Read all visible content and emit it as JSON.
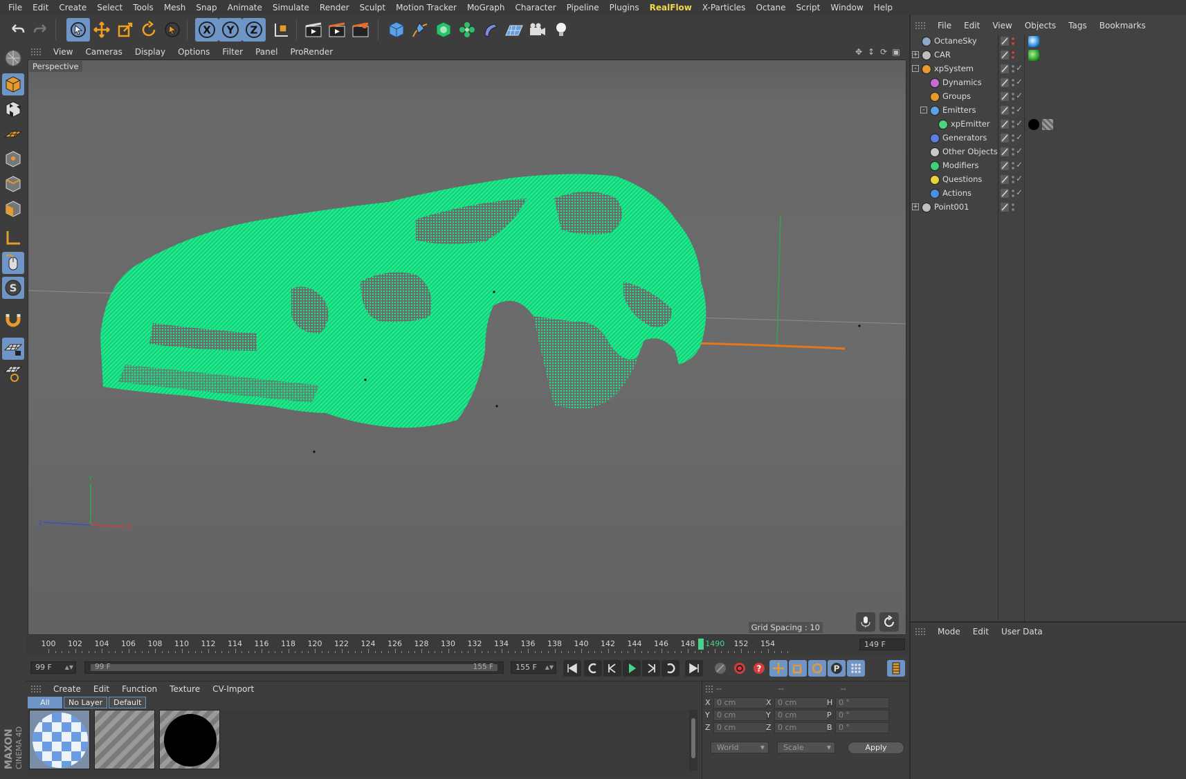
{
  "menubar": [
    "File",
    "Edit",
    "Create",
    "Select",
    "Tools",
    "Mesh",
    "Snap",
    "Animate",
    "Simulate",
    "Render",
    "Sculpt",
    "Motion Tracker",
    "MoGraph",
    "Character",
    "Pipeline",
    "Plugins",
    "RealFlow",
    "X-Particles",
    "Octane",
    "Script",
    "Window",
    "Help"
  ],
  "highlight_menu": "RealFlow",
  "viewport": {
    "menu": [
      "View",
      "Cameras",
      "Display",
      "Options",
      "Filter",
      "Panel",
      "ProRender"
    ],
    "label": "Perspective",
    "grid_spacing": "Grid Spacing : 10",
    "axes": {
      "y": "Y",
      "z": "Z",
      "x": "X"
    }
  },
  "timeline": {
    "ticks": [
      100,
      102,
      104,
      106,
      108,
      110,
      112,
      114,
      116,
      118,
      120,
      122,
      124,
      126,
      128,
      130,
      132,
      134,
      136,
      138,
      140,
      142,
      144,
      146,
      148,
      150,
      152,
      154
    ],
    "current_label": "1490",
    "current_frame": 149,
    "end_field": "149 F"
  },
  "transport": {
    "current": "99 F",
    "range_start": "99 F",
    "range_end": "155 F",
    "end": "155 F"
  },
  "materials": {
    "menu": [
      "Create",
      "Edit",
      "Function",
      "Texture",
      "CV-Import"
    ],
    "filters": [
      "All",
      "No Layer",
      "Default"
    ]
  },
  "coords": {
    "headers": [
      "--",
      "--",
      "--"
    ],
    "rows": [
      {
        "a": "X",
        "av": "0 cm",
        "b": "X",
        "bv": "0 cm",
        "c": "H",
        "cv": "0 °"
      },
      {
        "a": "Y",
        "av": "0 cm",
        "b": "Y",
        "bv": "0 cm",
        "c": "P",
        "cv": "0 °"
      },
      {
        "a": "Z",
        "av": "0 cm",
        "b": "Z",
        "bv": "0 cm",
        "c": "B",
        "cv": "0 °"
      }
    ],
    "space": "World",
    "mode": "Scale",
    "apply": "Apply"
  },
  "object_manager": {
    "menu": [
      "File",
      "Edit",
      "View",
      "Objects",
      "Tags",
      "Bookmarks"
    ],
    "objects": [
      {
        "name": "OctaneSky",
        "depth": 0,
        "icon": "sky-icon",
        "color": "#8fa8c9",
        "exp": ""
      },
      {
        "name": "CAR",
        "depth": 0,
        "icon": "null-icon",
        "color": "#bfbfbf",
        "exp": "+"
      },
      {
        "name": "xpSystem",
        "depth": 0,
        "icon": "xp-system-icon",
        "color": "#e59a2e",
        "exp": "-"
      },
      {
        "name": "Dynamics",
        "depth": 1,
        "icon": "dynamics-icon",
        "color": "#c76bd1",
        "exp": ""
      },
      {
        "name": "Groups",
        "depth": 1,
        "icon": "groups-icon",
        "color": "#e59a2e",
        "exp": ""
      },
      {
        "name": "Emitters",
        "depth": 1,
        "icon": "emitters-icon",
        "color": "#5ea0e6",
        "exp": "-"
      },
      {
        "name": "xpEmitter",
        "depth": 2,
        "icon": "xp-emitter-icon",
        "color": "#4fd07a",
        "exp": ""
      },
      {
        "name": "Generators",
        "depth": 1,
        "icon": "generators-icon",
        "color": "#5a7fe0",
        "exp": ""
      },
      {
        "name": "Other Objects",
        "depth": 1,
        "icon": "other-objects-icon",
        "color": "#c8c8c8",
        "exp": ""
      },
      {
        "name": "Modifiers",
        "depth": 1,
        "icon": "modifiers-icon",
        "color": "#3fcf7a",
        "exp": ""
      },
      {
        "name": "Questions",
        "depth": 1,
        "icon": "questions-icon",
        "color": "#e6d23a",
        "exp": ""
      },
      {
        "name": "Actions",
        "depth": 1,
        "icon": "actions-icon",
        "color": "#4a8fe0",
        "exp": ""
      },
      {
        "name": "Point001",
        "depth": 0,
        "icon": "null-icon",
        "color": "#bfbfbf",
        "exp": "+"
      }
    ]
  },
  "attributes": {
    "menu": [
      "Mode",
      "Edit",
      "User Data"
    ]
  },
  "colors": {
    "accent": "#6f95c7",
    "particles": "#1de98b",
    "timeline_marker": "#47d488"
  }
}
